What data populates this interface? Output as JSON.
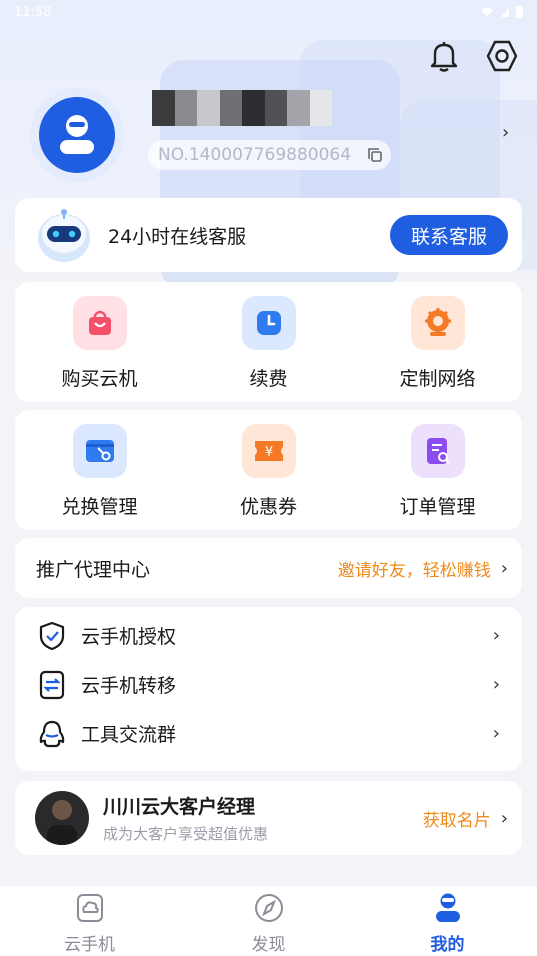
{
  "status_bar": {
    "time": "11:58"
  },
  "profile": {
    "id_text": "NO.140007769880064"
  },
  "service": {
    "text": "24小时在线客服",
    "button": "联系客服"
  },
  "grid1": [
    {
      "label": "购买云机",
      "icon": "shopping-bag-icon",
      "color": "#f4506a"
    },
    {
      "label": "续费",
      "icon": "clock-icon",
      "color": "#2f7bf0"
    },
    {
      "label": "定制网络",
      "icon": "gear-globe-icon",
      "color": "#f57a28"
    }
  ],
  "grid2": [
    {
      "label": "兑换管理",
      "icon": "wallet-key-icon",
      "color": "#2f7bf0"
    },
    {
      "label": "优惠券",
      "icon": "coupon-icon",
      "color": "#f57a28"
    },
    {
      "label": "订单管理",
      "icon": "order-search-icon",
      "color": "#8b4cf0"
    }
  ],
  "promo": {
    "title": "推广代理中心",
    "action": "邀请好友，轻松赚钱"
  },
  "list": [
    {
      "label": "云手机授权",
      "icon": "shield-check-icon"
    },
    {
      "label": "云手机转移",
      "icon": "transfer-icon"
    },
    {
      "label": "工具交流群",
      "icon": "qq-penguin-icon"
    }
  ],
  "manager": {
    "title": "川川云大客户经理",
    "subtitle": "成为大客户享受超值优惠",
    "action": "获取名片"
  },
  "tabs": [
    {
      "label": "云手机",
      "icon": "cloud-phone-icon"
    },
    {
      "label": "发现",
      "icon": "compass-icon"
    },
    {
      "label": "我的",
      "icon": "user-icon",
      "active": true
    }
  ],
  "colors": {
    "primary": "#1f5ee0",
    "accent": "#f08a1c"
  }
}
